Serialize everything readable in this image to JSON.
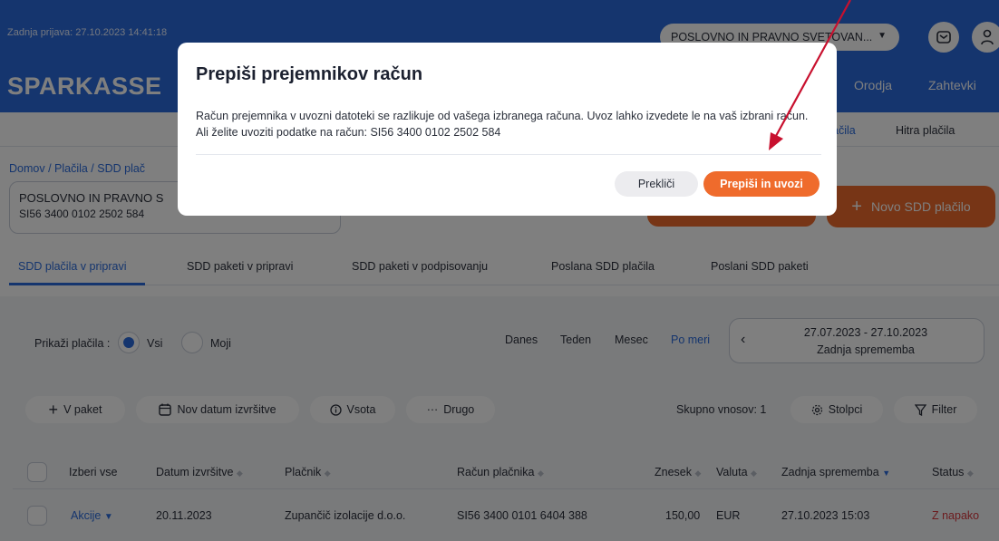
{
  "header": {
    "last_login": "Zadnja prijava: 27.10.2023 14:41:18",
    "client_selector": "POSLOVNO IN PRAVNO SVETOVAN...",
    "logo": "SPARKASSE",
    "main_nav": [
      "Orodja",
      "Zahtevki"
    ]
  },
  "sub_nav": {
    "items": [
      "ačila",
      "Hitra plačila"
    ]
  },
  "breadcrumb": "Domov  /  Plačila  /  SDD plač",
  "account": {
    "name": "POSLOVNO IN PRAVNO S",
    "iban": "SI56 3400 0102 2502 584"
  },
  "new_sdd_button": {
    "plus": "+",
    "label": "Novo SDD plačilo"
  },
  "tabs": [
    "SDD plačila v pripravi",
    "SDD paketi v pripravi",
    "SDD paketi v podpisovanju",
    "Poslana SDD plačila",
    "Poslani SDD paketi"
  ],
  "filters": {
    "show_label": "Prikaži plačila :",
    "radio_all": "Vsi",
    "radio_mine": "Moji",
    "periods": [
      "Danes",
      "Teden",
      "Mesec",
      "Po meri"
    ],
    "date_range": "27.07.2023 - 27.10.2023",
    "date_sub": "Zadnja sprememba"
  },
  "actions": {
    "to_package": "V paket",
    "new_date": "Nov datum izvršitve",
    "sum": "Vsota",
    "other": "Drugo",
    "total": "Skupno vnosov: 1",
    "columns": "Stolpci",
    "filter": "Filter"
  },
  "table": {
    "headers": [
      "Izberi vse",
      "Datum izvršitve",
      "Plačnik",
      "Račun plačnika",
      "Znesek",
      "Valuta",
      "Zadnja sprememba",
      "Status"
    ],
    "rows": [
      {
        "actions": "Akcije",
        "date": "20.11.2023",
        "payer": "Zupančič izolacije d.o.o.",
        "account": "SI56 3400 0101 6404 388",
        "amount": "150,00",
        "currency": "EUR",
        "modified": "27.10.2023 15:03",
        "status": "Z napako"
      }
    ]
  },
  "modal": {
    "title": "Prepiši prejemnikov račun",
    "text": "Račun prejemnika v uvozni datoteki se razlikuje od vašega izbranega računa. Uvoz lahko izvedete le na vaš izbrani račun. Ali želite uvoziti podatke na račun: SI56 3400 0102 2502 584",
    "cancel": "Prekliči",
    "confirm": "Prepiši in uvozi"
  },
  "colors": {
    "brand_blue": "#2a6bdc",
    "accent_orange": "#ef6b2c",
    "annotation_red": "#c8102e",
    "error_red": "#d8373d"
  }
}
